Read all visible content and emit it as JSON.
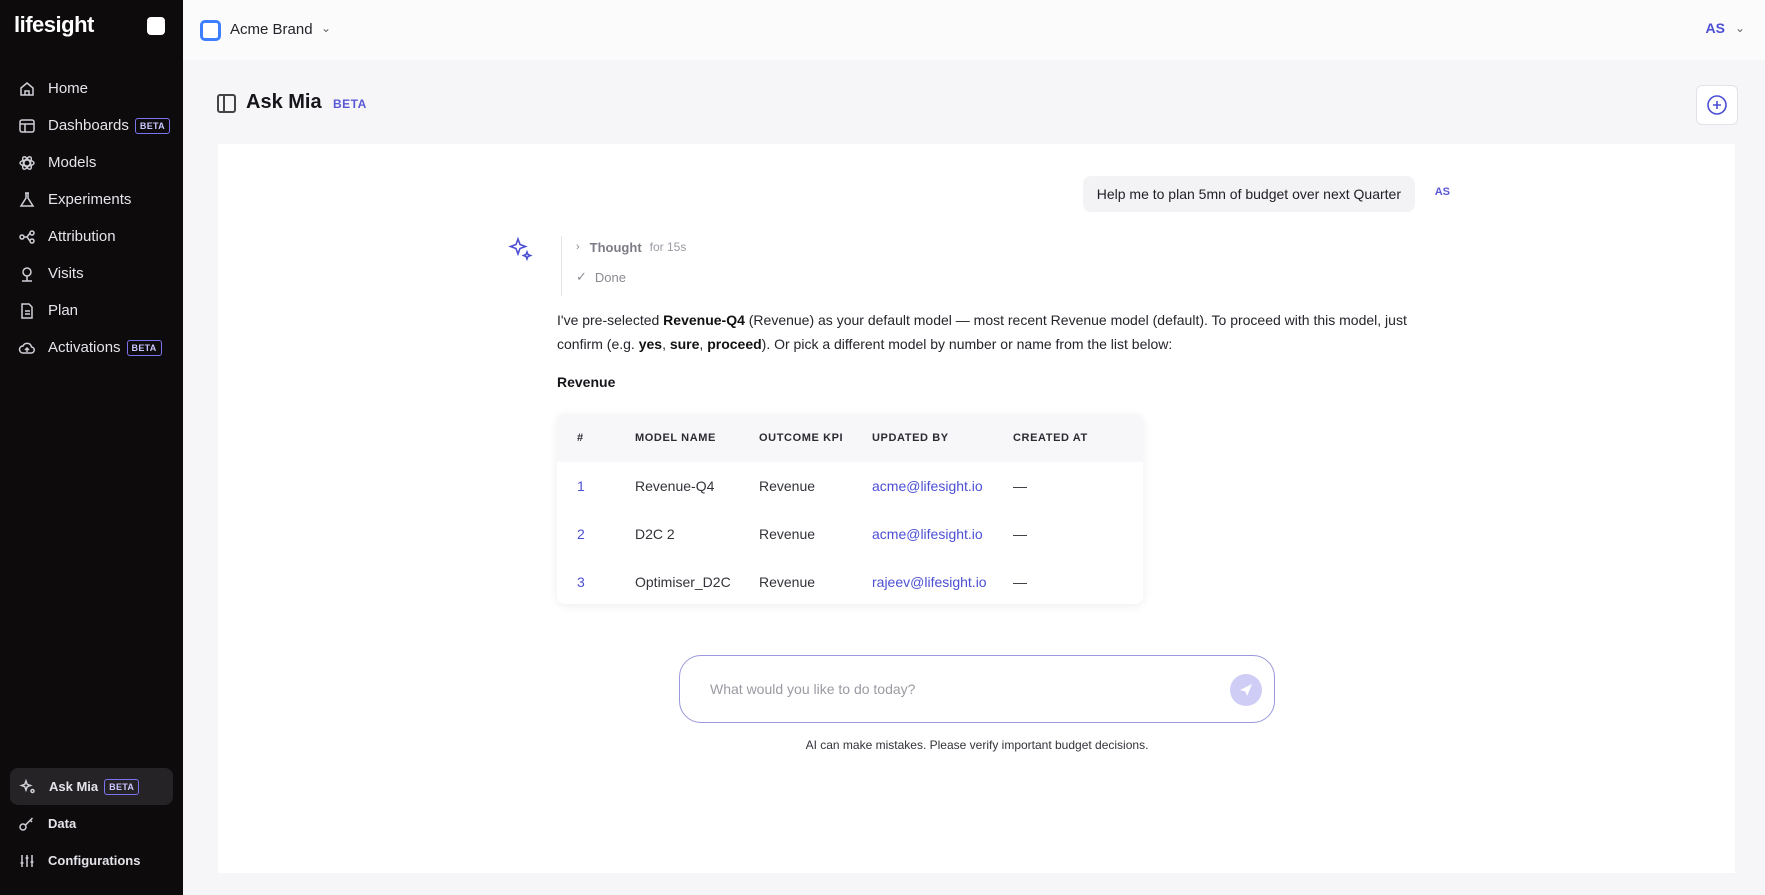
{
  "sidebar": {
    "logo": "lifesight",
    "items": [
      {
        "label": "Home",
        "icon": "home-icon"
      },
      {
        "label": "Dashboards",
        "icon": "dashboard-icon",
        "badge": "BETA"
      },
      {
        "label": "Models",
        "icon": "models-icon"
      },
      {
        "label": "Experiments",
        "icon": "flask-icon"
      },
      {
        "label": "Attribution",
        "icon": "attribution-icon"
      },
      {
        "label": "Visits",
        "icon": "visits-icon"
      },
      {
        "label": "Plan",
        "icon": "document-icon"
      },
      {
        "label": "Activations",
        "icon": "cloud-upload-icon",
        "badge": "BETA"
      }
    ],
    "bottom": [
      {
        "label": "Ask Mia",
        "icon": "sparkle-icon",
        "badge": "BETA",
        "active": true
      },
      {
        "label": "Data",
        "icon": "key-icon"
      },
      {
        "label": "Configurations",
        "icon": "sliders-icon"
      }
    ]
  },
  "topbar": {
    "brand": "Acme Brand",
    "user_initials": "AS"
  },
  "header": {
    "title": "Ask Mia",
    "badge": "BETA"
  },
  "chat": {
    "user_message": "Help me to plan 5mn of budget over next Quarter",
    "user_tag": "AS",
    "thought_label": "Thought",
    "thought_duration": "for 15s",
    "done_label": "Done",
    "answer_parts": {
      "p1": "I've pre-selected ",
      "model": "Revenue-Q4",
      "p2": " (Revenue) as your default model — most recent Revenue model (default). To proceed with this model, just confirm (e.g. ",
      "yes": "yes",
      "comma1": ", ",
      "sure": "sure",
      "comma2": ", ",
      "proceed": "proceed",
      "p3": "). Or pick a different model by number or name from the list below:"
    },
    "section_title": "Revenue",
    "table": {
      "headers": [
        "#",
        "MODEL NAME",
        "OUTCOME KPI",
        "UPDATED BY",
        "CREATED AT"
      ],
      "rows": [
        {
          "idx": "1",
          "name": "Revenue-Q4",
          "kpi": "Revenue",
          "updated_by": "acme@lifesight.io",
          "created_at": "—"
        },
        {
          "idx": "2",
          "name": "D2C 2",
          "kpi": "Revenue",
          "updated_by": "acme@lifesight.io",
          "created_at": "—"
        },
        {
          "idx": "3",
          "name": "Optimiser_D2C",
          "kpi": "Revenue",
          "updated_by": "rajeev@lifesight.io",
          "created_at": "—"
        }
      ]
    }
  },
  "composer": {
    "placeholder": "What would you like to do today?",
    "disclaimer": "AI can make mistakes. Please verify important budget decisions."
  },
  "colors": {
    "sidebar_bg": "#0d0b0c",
    "accent": "#4c4fd4",
    "brand_square": "#3d7fff"
  }
}
